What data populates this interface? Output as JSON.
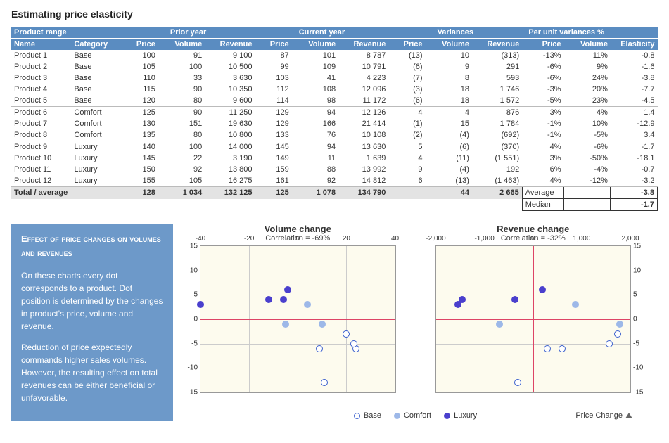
{
  "title": "Estimating price elasticity",
  "headers": {
    "group_product": "Product range",
    "group_prior": "Prior year",
    "group_current": "Current year",
    "group_variances": "Variances",
    "group_pct": "Per unit variances %",
    "name": "Name",
    "category": "Category",
    "price": "Price",
    "volume": "Volume",
    "revenue": "Revenue",
    "elasticity": "Elasticity"
  },
  "rows": [
    {
      "name": "Product 1",
      "cat": "Base",
      "p0": "100",
      "v0": "91",
      "r0": "9 100",
      "p1": "87",
      "v1": "101",
      "r1": "8 787",
      "dp": "(13)",
      "dv": "10",
      "dr": "(313)",
      "pp": "-13%",
      "pv": "11%",
      "e": "-0.8"
    },
    {
      "name": "Product 2",
      "cat": "Base",
      "p0": "105",
      "v0": "100",
      "r0": "10 500",
      "p1": "99",
      "v1": "109",
      "r1": "10 791",
      "dp": "(6)",
      "dv": "9",
      "dr": "291",
      "pp": "-6%",
      "pv": "9%",
      "e": "-1.6"
    },
    {
      "name": "Product 3",
      "cat": "Base",
      "p0": "110",
      "v0": "33",
      "r0": "3 630",
      "p1": "103",
      "v1": "41",
      "r1": "4 223",
      "dp": "(7)",
      "dv": "8",
      "dr": "593",
      "pp": "-6%",
      "pv": "24%",
      "e": "-3.8"
    },
    {
      "name": "Product 4",
      "cat": "Base",
      "p0": "115",
      "v0": "90",
      "r0": "10 350",
      "p1": "112",
      "v1": "108",
      "r1": "12 096",
      "dp": "(3)",
      "dv": "18",
      "dr": "1 746",
      "pp": "-3%",
      "pv": "20%",
      "e": "-7.7"
    },
    {
      "name": "Product 5",
      "cat": "Base",
      "p0": "120",
      "v0": "80",
      "r0": "9 600",
      "p1": "114",
      "v1": "98",
      "r1": "11 172",
      "dp": "(6)",
      "dv": "18",
      "dr": "1 572",
      "pp": "-5%",
      "pv": "23%",
      "e": "-4.5"
    },
    {
      "name": "Product 6",
      "cat": "Comfort",
      "p0": "125",
      "v0": "90",
      "r0": "11 250",
      "p1": "129",
      "v1": "94",
      "r1": "12 126",
      "dp": "4",
      "dv": "4",
      "dr": "876",
      "pp": "3%",
      "pv": "4%",
      "e": "1.4"
    },
    {
      "name": "Product 7",
      "cat": "Comfort",
      "p0": "130",
      "v0": "151",
      "r0": "19 630",
      "p1": "129",
      "v1": "166",
      "r1": "21 414",
      "dp": "(1)",
      "dv": "15",
      "dr": "1 784",
      "pp": "-1%",
      "pv": "10%",
      "e": "-12.9"
    },
    {
      "name": "Product 8",
      "cat": "Comfort",
      "p0": "135",
      "v0": "80",
      "r0": "10 800",
      "p1": "133",
      "v1": "76",
      "r1": "10 108",
      "dp": "(2)",
      "dv": "(4)",
      "dr": "(692)",
      "pp": "-1%",
      "pv": "-5%",
      "e": "3.4"
    },
    {
      "name": "Product 9",
      "cat": "Luxury",
      "p0": "140",
      "v0": "100",
      "r0": "14 000",
      "p1": "145",
      "v1": "94",
      "r1": "13 630",
      "dp": "5",
      "dv": "(6)",
      "dr": "(370)",
      "pp": "4%",
      "pv": "-6%",
      "e": "-1.7"
    },
    {
      "name": "Product 10",
      "cat": "Luxury",
      "p0": "145",
      "v0": "22",
      "r0": "3 190",
      "p1": "149",
      "v1": "11",
      "r1": "1 639",
      "dp": "4",
      "dv": "(11)",
      "dr": "(1 551)",
      "pp": "3%",
      "pv": "-50%",
      "e": "-18.1"
    },
    {
      "name": "Product 11",
      "cat": "Luxury",
      "p0": "150",
      "v0": "92",
      "r0": "13 800",
      "p1": "159",
      "v1": "88",
      "r1": "13 992",
      "dp": "9",
      "dv": "(4)",
      "dr": "192",
      "pp": "6%",
      "pv": "-4%",
      "e": "-0.7"
    },
    {
      "name": "Product 12",
      "cat": "Luxury",
      "p0": "155",
      "v0": "105",
      "r0": "16 275",
      "p1": "161",
      "v1": "92",
      "r1": "14 812",
      "dp": "6",
      "dv": "(13)",
      "dr": "(1 463)",
      "pp": "4%",
      "pv": "-12%",
      "e": "-3.2"
    }
  ],
  "total": {
    "label": "Total / average",
    "p0": "128",
    "v0": "1 034",
    "r0": "132 125",
    "p1": "125",
    "v1": "1 078",
    "r1": "134 790",
    "dv": "44",
    "dr": "2 665"
  },
  "summary": {
    "avg_label": "Average",
    "avg": "-3.8",
    "med_label": "Median",
    "med": "-1.7"
  },
  "panel": {
    "title": "Effect of price changes on volumes and revenues",
    "p1": "On these charts every dot corresponds to a product. Dot position is determined by the changes in product's price, volume and revenue.",
    "p2": "Reduction of price expectedly commands higher sales volumes. However, the resulting effect on total revenues  can be either beneficial or unfavorable."
  },
  "legend": {
    "base": "Base",
    "comfort": "Comfort",
    "luxury": "Luxury",
    "price_change": "Price Change"
  },
  "chart_data": [
    {
      "type": "scatter",
      "title": "Volume change",
      "subtitle": "Correlation = -69%",
      "xlabel": "",
      "ylabel": "",
      "xlim": [
        -40,
        40
      ],
      "ylim": [
        -15,
        15
      ],
      "x_ticks": [
        -40,
        -20,
        0,
        20,
        40
      ],
      "y_ticks": [
        -15,
        -10,
        -5,
        0,
        5,
        10,
        15
      ],
      "series": [
        {
          "name": "Base",
          "points": [
            {
              "x": 11,
              "y": -13
            },
            {
              "x": 9,
              "y": -6
            },
            {
              "x": 24,
              "y": -6
            },
            {
              "x": 20,
              "y": -3
            },
            {
              "x": 23,
              "y": -5
            }
          ]
        },
        {
          "name": "Comfort",
          "points": [
            {
              "x": 4,
              "y": 3
            },
            {
              "x": 10,
              "y": -1
            },
            {
              "x": -5,
              "y": -1
            }
          ]
        },
        {
          "name": "Luxury",
          "points": [
            {
              "x": -6,
              "y": 4
            },
            {
              "x": -50,
              "y": 3
            },
            {
              "x": -4,
              "y": 6
            },
            {
              "x": -12,
              "y": 4
            }
          ]
        }
      ]
    },
    {
      "type": "scatter",
      "title": "Revenue change",
      "subtitle": "Correlation = -32%",
      "xlabel": "",
      "ylabel": "",
      "xlim": [
        -2000,
        2000
      ],
      "ylim": [
        -15,
        15
      ],
      "x_ticks": [
        -2000,
        -1000,
        0,
        1000,
        2000
      ],
      "y_ticks": [
        -15,
        -10,
        -5,
        0,
        5,
        10,
        15
      ],
      "series": [
        {
          "name": "Base",
          "points": [
            {
              "x": -313,
              "y": -13
            },
            {
              "x": 291,
              "y": -6
            },
            {
              "x": 593,
              "y": -6
            },
            {
              "x": 1746,
              "y": -3
            },
            {
              "x": 1572,
              "y": -5
            }
          ]
        },
        {
          "name": "Comfort",
          "points": [
            {
              "x": 876,
              "y": 3
            },
            {
              "x": 1784,
              "y": -1
            },
            {
              "x": -692,
              "y": -1
            }
          ]
        },
        {
          "name": "Luxury",
          "points": [
            {
              "x": -370,
              "y": 4
            },
            {
              "x": -1551,
              "y": 3
            },
            {
              "x": 192,
              "y": 6
            },
            {
              "x": -1463,
              "y": 4
            }
          ]
        }
      ]
    }
  ]
}
